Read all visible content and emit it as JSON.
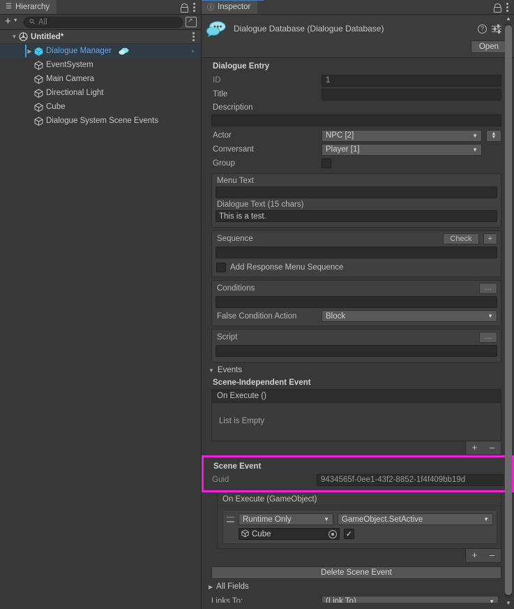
{
  "hierarchy": {
    "tab_label": "Hierarchy",
    "tab_icon": "hierarchy-icon",
    "create_label": "+",
    "search": {
      "placeholder": "All",
      "value": ""
    },
    "scene_name": "Untitled*",
    "items": [
      {
        "label": "Dialogue Manager",
        "selected": true,
        "expandable": true,
        "has_bubble_icon": true
      },
      {
        "label": "EventSystem",
        "selected": false,
        "expandable": false
      },
      {
        "label": "Main Camera",
        "selected": false,
        "expandable": false
      },
      {
        "label": "Directional Light",
        "selected": false,
        "expandable": false
      },
      {
        "label": "Cube",
        "selected": false,
        "expandable": false
      },
      {
        "label": "Dialogue System Scene Events",
        "selected": false,
        "expandable": false
      }
    ]
  },
  "inspector": {
    "tab_label": "Inspector",
    "asset_title": "Dialogue Database (Dialogue Database)",
    "open_button": "Open",
    "section_title": "Dialogue Entry",
    "fields": {
      "id_label": "ID",
      "id_value": "1",
      "title_label": "Title",
      "title_value": "",
      "description_label": "Description",
      "description_value": "",
      "actor_label": "Actor",
      "actor_value": "NPC [2]",
      "conversant_label": "Conversant",
      "conversant_value": "Player [1]",
      "group_label": "Group",
      "group_checked": false
    },
    "text_group": {
      "menu_text_label": "Menu Text",
      "menu_text_value": "",
      "dialogue_text_label": "Dialogue Text (15 chars)",
      "dialogue_text_value": "This is a test."
    },
    "sequence_group": {
      "label": "Sequence",
      "check_button": "Check",
      "add_button": "+",
      "value": "",
      "response_menu_label": "Add Response Menu Sequence",
      "response_menu_checked": false
    },
    "conditions_group": {
      "label": "Conditions",
      "dots_button": "...",
      "value": "",
      "false_action_label": "False Condition Action",
      "false_action_value": "Block"
    },
    "script_group": {
      "label": "Script",
      "dots_button": "...",
      "value": ""
    },
    "events": {
      "fold_label": "Events",
      "scene_independent_title": "Scene-Independent Event",
      "on_execute_label": "On Execute ()",
      "empty_label": "List is Empty",
      "add_label": "+",
      "remove_label": "–"
    },
    "scene_event": {
      "title": "Scene Event",
      "guid_label": "Guid",
      "guid_value": "9434565f-0ee1-43f2-8852-1f4f409bb19d",
      "highlight_color": "#f020dc",
      "on_execute_label": "On Execute (GameObject)",
      "listener_mode": "Runtime Only",
      "listener_function": "GameObject.SetActive",
      "target_object": "Cube",
      "arg_checked": true,
      "add_label": "+",
      "remove_label": "–",
      "delete_button": "Delete Scene Event"
    },
    "all_fields_label": "All Fields",
    "links_to_label": "Links To:",
    "links_to_value": "(Link To)"
  }
}
